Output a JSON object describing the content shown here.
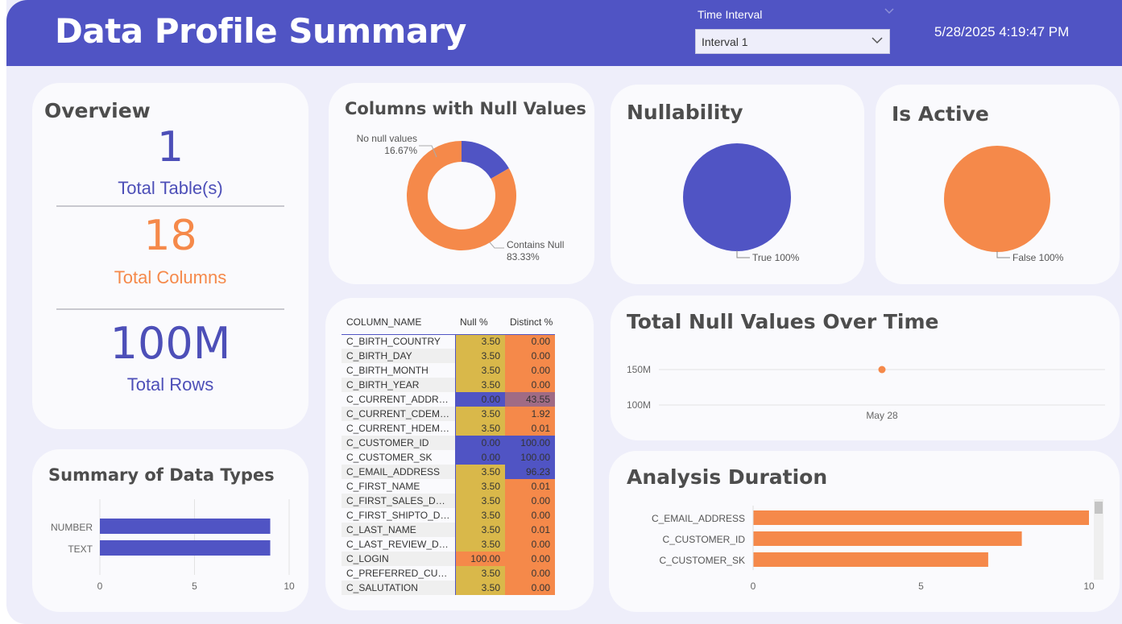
{
  "header": {
    "title": "Data Profile Summary",
    "time_interval_label": "Time Interval",
    "time_interval_value": "Interval 1",
    "timestamp": "5/28/2025 4:19:47 PM"
  },
  "overview": {
    "title": "Overview",
    "tables_value": "1",
    "tables_label": "Total Table(s)",
    "columns_value": "18",
    "columns_label": "Total Columns",
    "rows_value": "100M",
    "rows_label": "Total Rows"
  },
  "null_donut": {
    "title": "Columns with Null Values",
    "no_null_label": "No null values",
    "no_null_pct": "16.67%",
    "contains_null_label": "Contains Null",
    "contains_null_pct": "83.33%"
  },
  "nullability": {
    "title": "Nullability",
    "label": "True 100%"
  },
  "is_active": {
    "title": "Is Active",
    "label": "False 100%"
  },
  "data_types": {
    "title": "Summary of Data Types",
    "ticks": [
      "0",
      "5",
      "10"
    ]
  },
  "null_over_time": {
    "title": "Total Null Values Over Time",
    "y_ticks": [
      "150M",
      "100M"
    ],
    "x_label": "May 28"
  },
  "analysis_duration": {
    "title": "Analysis Duration",
    "ticks": [
      "0",
      "5",
      "10"
    ]
  },
  "column_table": {
    "headers": [
      "COLUMN_NAME",
      "Null %",
      "Distinct %"
    ],
    "rows": [
      [
        "C_BIRTH_COUNTRY",
        "3.50",
        "0.00"
      ],
      [
        "C_BIRTH_DAY",
        "3.50",
        "0.00"
      ],
      [
        "C_BIRTH_MONTH",
        "3.50",
        "0.00"
      ],
      [
        "C_BIRTH_YEAR",
        "3.50",
        "0.00"
      ],
      [
        "C_CURRENT_ADDR_SK",
        "0.00",
        "43.55"
      ],
      [
        "C_CURRENT_CDEMO_...",
        "3.50",
        "1.92"
      ],
      [
        "C_CURRENT_HDEMO_...",
        "3.50",
        "0.01"
      ],
      [
        "C_CUSTOMER_ID",
        "0.00",
        "100.00"
      ],
      [
        "C_CUSTOMER_SK",
        "0.00",
        "100.00"
      ],
      [
        "C_EMAIL_ADDRESS",
        "3.50",
        "96.23"
      ],
      [
        "C_FIRST_NAME",
        "3.50",
        "0.01"
      ],
      [
        "C_FIRST_SALES_DATE_...",
        "3.50",
        "0.00"
      ],
      [
        "C_FIRST_SHIPTO_DATE...",
        "3.50",
        "0.00"
      ],
      [
        "C_LAST_NAME",
        "3.50",
        "0.01"
      ],
      [
        "C_LAST_REVIEW_DATE",
        "3.50",
        "0.00"
      ],
      [
        "C_LOGIN",
        "100.00",
        "0.00"
      ],
      [
        "C_PREFERRED_CUST_F...",
        "3.50",
        "0.00"
      ],
      [
        "C_SALUTATION",
        "3.50",
        "0.00"
      ]
    ]
  },
  "colors": {
    "navy": "#5054c4",
    "orange": "#f5894a",
    "gold": "#d9b84a",
    "mauve": "#a06b85"
  },
  "chart_data": [
    {
      "type": "pie",
      "title": "Columns with Null Values",
      "categories": [
        "No null values",
        "Contains Null"
      ],
      "values": [
        16.67,
        83.33
      ],
      "colors": [
        "#5054c4",
        "#f5894a"
      ],
      "donut": true
    },
    {
      "type": "pie",
      "title": "Nullability",
      "categories": [
        "True"
      ],
      "values": [
        100
      ],
      "colors": [
        "#5054c4"
      ]
    },
    {
      "type": "pie",
      "title": "Is Active",
      "categories": [
        "False"
      ],
      "values": [
        100
      ],
      "colors": [
        "#f5894a"
      ]
    },
    {
      "type": "bar",
      "orientation": "horizontal",
      "title": "Summary of Data Types",
      "categories": [
        "NUMBER",
        "TEXT"
      ],
      "values": [
        9,
        9
      ],
      "xlim": [
        0,
        10
      ],
      "grid": true
    },
    {
      "type": "scatter",
      "title": "Total Null Values Over Time",
      "x": [
        "May 28"
      ],
      "values": [
        150000000
      ],
      "ylim": [
        100000000,
        150000000
      ]
    },
    {
      "type": "bar",
      "orientation": "horizontal",
      "title": "Analysis Duration",
      "categories": [
        "C_EMAIL_ADDRESS",
        "C_CUSTOMER_ID",
        "C_CUSTOMER_SK"
      ],
      "values": [
        10,
        8,
        7
      ],
      "xlim": [
        0,
        10
      ]
    }
  ]
}
